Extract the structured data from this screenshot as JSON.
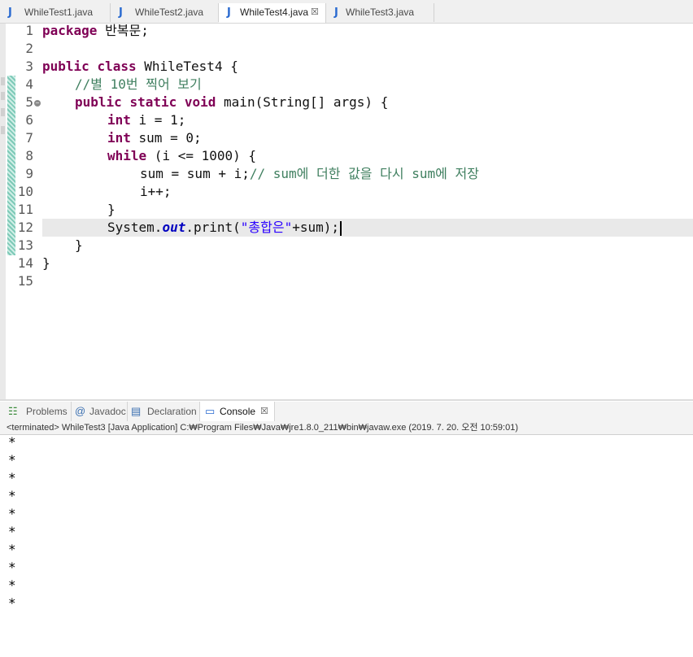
{
  "editor_tabs": [
    {
      "label": "WhileTest1.java",
      "icon": "java-file-icon",
      "active": false
    },
    {
      "label": "WhileTest2.java",
      "icon": "java-file-icon",
      "active": false
    },
    {
      "label": "WhileTest4.java",
      "icon": "java-file-icon",
      "active": true,
      "close": "☒"
    },
    {
      "label": "WhileTest3.java",
      "icon": "java-file-icon",
      "active": false
    }
  ],
  "code": {
    "line_numbers": [
      "1",
      "2",
      "3",
      "4",
      "5",
      "6",
      "7",
      "8",
      "9",
      "10",
      "11",
      "12",
      "13",
      "14",
      "15"
    ],
    "lines": {
      "l1_kw": "package",
      "l1_rest": " 반복문;",
      "l3_kw1": "public",
      "l3_kw2": "class",
      "l3_rest": " WhileTest4 {",
      "l4_comment": "//별 10번 찍어 보기",
      "l5_kw1": "public",
      "l5_kw2": "static",
      "l5_kw3": "void",
      "l5_rest": " main(String[] args) {",
      "l6_kw": "int",
      "l6_rest": " i = 1;",
      "l7_kw": "int",
      "l7_rest": " sum = 0;",
      "l8_kw": "while",
      "l8_rest": " (i <= 1000) {",
      "l9_code": "sum = sum + i;",
      "l9_comment": "// sum에 더한 값을 다시 sum에 저장",
      "l10_code": "i++;",
      "l11_code": "}",
      "l12_pre": "System.",
      "l12_field": "out",
      "l12_mid": ".print(",
      "l12_str": "\"총합은\"",
      "l12_post": "+sum);",
      "l13_code": "}",
      "l14_code": "}"
    }
  },
  "panel_tabs": [
    {
      "label": "Problems",
      "icon": "problems-icon"
    },
    {
      "label": "Javadoc",
      "icon": "javadoc-icon"
    },
    {
      "label": "Declaration",
      "icon": "declaration-icon"
    },
    {
      "label": "Console",
      "icon": "console-icon",
      "active": true,
      "close": "☒"
    }
  ],
  "console": {
    "status": "<terminated> WhileTest3 [Java Application] C:₩Program Files₩Java₩jre1.8.0_211₩bin₩javaw.exe (2019. 7. 20. 오전 10:59:01)",
    "output": [
      "*",
      "*",
      "*",
      "*",
      "*",
      "*",
      "*",
      "*",
      "*",
      "*"
    ]
  },
  "colors": {
    "keyword": "#7f0055",
    "comment": "#3f7f5f",
    "string": "#2a00ff",
    "field": "#0000c0",
    "java_icon": "#2a6ad0"
  }
}
